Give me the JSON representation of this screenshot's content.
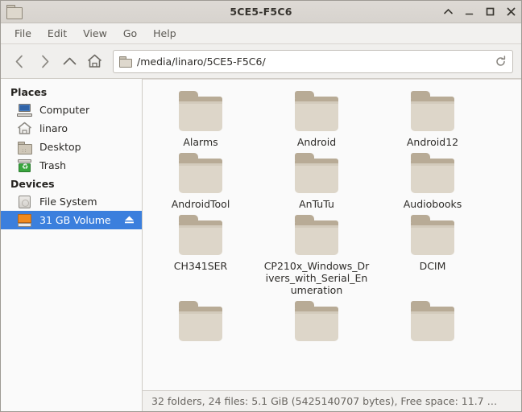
{
  "window": {
    "title": "5CE5-F5C6",
    "icon": "folder-icon",
    "controls": [
      {
        "name": "shade-button",
        "glyph": "^"
      },
      {
        "name": "minimize-button",
        "glyph": "_"
      },
      {
        "name": "maximize-button",
        "glyph": "□"
      },
      {
        "name": "close-button",
        "glyph": "✕"
      }
    ]
  },
  "menubar": {
    "items": [
      {
        "label": "File"
      },
      {
        "label": "Edit"
      },
      {
        "label": "View"
      },
      {
        "label": "Go"
      },
      {
        "label": "Help"
      }
    ]
  },
  "toolbar": {
    "back_icon": "chevron-left-icon",
    "forward_icon": "chevron-right-icon",
    "up_icon": "chevron-up-icon",
    "home_icon": "home-icon",
    "reload_icon": "reload-icon",
    "path_icon": "folder-icon",
    "path_value": "/media/linaro/5CE5-F5C6/"
  },
  "sidebar": {
    "sections": [
      {
        "title": "Places",
        "items": [
          {
            "label": "Computer",
            "icon": "computer-icon",
            "selected": false
          },
          {
            "label": "linaro",
            "icon": "home-icon",
            "selected": false
          },
          {
            "label": "Desktop",
            "icon": "folder-icon",
            "selected": false
          },
          {
            "label": "Trash",
            "icon": "trash-icon",
            "selected": false
          }
        ]
      },
      {
        "title": "Devices",
        "items": [
          {
            "label": "File System",
            "icon": "harddisk-icon",
            "selected": false
          },
          {
            "label": "31 GB Volume",
            "icon": "drive-icon",
            "selected": true,
            "eject": "⏏"
          }
        ]
      }
    ]
  },
  "content": {
    "rows": [
      [
        {
          "name": "Alarms",
          "icon": "folder-icon"
        },
        {
          "name": "Android",
          "icon": "folder-icon"
        },
        {
          "name": "Android12",
          "icon": "folder-icon"
        }
      ],
      [
        {
          "name": "AndroidTool",
          "icon": "folder-icon"
        },
        {
          "name": "AnTuTu",
          "icon": "folder-icon"
        },
        {
          "name": "Audiobooks",
          "icon": "folder-icon"
        }
      ],
      [
        {
          "name": "CH341SER",
          "icon": "folder-icon"
        },
        {
          "name": "CP210x_Windows_Drivers_with_Serial_Enumeration",
          "icon": "folder-icon"
        },
        {
          "name": "DCIM",
          "icon": "folder-icon"
        }
      ],
      [
        {
          "name": "",
          "icon": "folder-icon"
        },
        {
          "name": "",
          "icon": "folder-icon"
        },
        {
          "name": "",
          "icon": "folder-icon"
        }
      ]
    ]
  },
  "statusbar": {
    "text": "32 folders, 24 files: 5.1 GiB (5425140707 bytes), Free space: 11.7 …"
  },
  "colors": {
    "selection_blue": "#3b7fdd",
    "folder_body": "#ddd6c9",
    "folder_tab": "#b8ab96",
    "drive_orange": "#f08a1e",
    "trash_green": "#3aa63f"
  }
}
